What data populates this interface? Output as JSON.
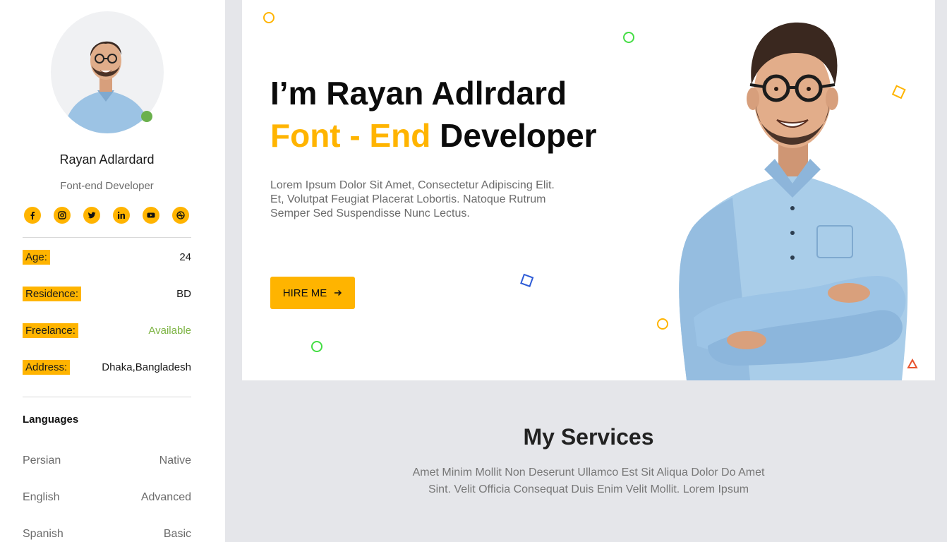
{
  "profile": {
    "name": "Rayan Adlardard",
    "role": "Font-end Developer",
    "socials": [
      "facebook-icon",
      "instagram-icon",
      "twitter-icon",
      "linkedin-icon",
      "youtube-icon",
      "dribbble-icon"
    ]
  },
  "info": [
    {
      "label": "Age:",
      "value": "24"
    },
    {
      "label": "Residence:",
      "value": "BD"
    },
    {
      "label": "Freelance:",
      "value": "Available"
    },
    {
      "label": "Address:",
      "value": "Dhaka,Bangladesh"
    }
  ],
  "languages": {
    "title": "Languages",
    "items": [
      {
        "name": "Persian",
        "level": "Native"
      },
      {
        "name": "English",
        "level": "Advanced"
      },
      {
        "name": "Spanish",
        "level": "Basic"
      }
    ]
  },
  "hero": {
    "title": "I’m Rayan Adlrdard",
    "subtitle_accent": "Font - End",
    "subtitle_rest": "Developer",
    "description": "Lorem Ipsum Dolor Sit Amet, Consectetur Adipiscing Elit. Et, Volutpat Feugiat Placerat Lobortis. Natoque Rutrum Semper Sed Suspendisse Nunc Lectus.",
    "button_label": "HIRE ME"
  },
  "services": {
    "title": "My Services",
    "description": "Amet Minim Mollit Non Deserunt Ullamco Est Sit Aliqua Dolor Do Amet Sint. Velit Officia Consequat Duis Enim Velit Mollit. Lorem Ipsum"
  },
  "colors": {
    "accent": "#ffb400",
    "available": "#7cb342",
    "online": "#6ab04c",
    "background": "#e5e6ea"
  }
}
